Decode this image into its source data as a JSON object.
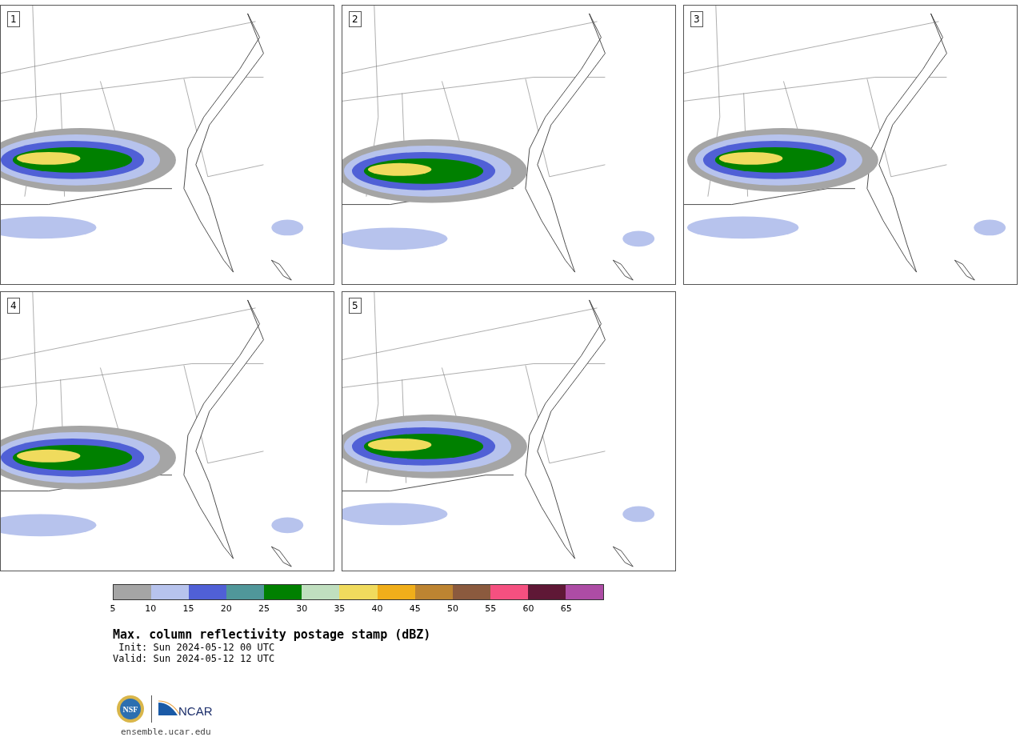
{
  "panels": [
    {
      "label": "1"
    },
    {
      "label": "2"
    },
    {
      "label": "3"
    },
    {
      "label": "4"
    },
    {
      "label": "5"
    }
  ],
  "colorbar": {
    "segments": [
      {
        "color": "#a5a5a5"
      },
      {
        "color": "#b7c3ed"
      },
      {
        "color": "#5060d6"
      },
      {
        "color": "#50979a"
      },
      {
        "color": "#008000"
      },
      {
        "color": "#c0dfbf"
      },
      {
        "color": "#f0db5d"
      },
      {
        "color": "#f0ae1a"
      },
      {
        "color": "#bd8431"
      },
      {
        "color": "#8b5a3e"
      },
      {
        "color": "#f55080"
      },
      {
        "color": "#5f1836"
      },
      {
        "color": "#ad4ca5"
      }
    ],
    "ticks": [
      "5",
      "10",
      "15",
      "20",
      "25",
      "30",
      "35",
      "40",
      "45",
      "50",
      "55",
      "60",
      "65"
    ]
  },
  "title": "Max. column reflectivity postage stamp (dBZ)",
  "init": " Init: Sun 2024-05-12 00 UTC",
  "valid": "Valid: Sun 2024-05-12 12 UTC",
  "logos": {
    "nsf": "NSF",
    "ncar": "NCAR"
  },
  "url": "ensemble.ucar.edu"
}
